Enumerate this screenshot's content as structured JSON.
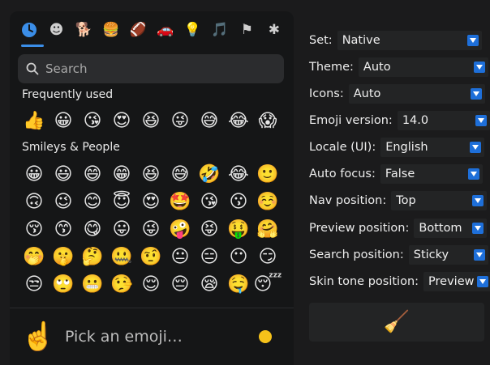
{
  "nav": {
    "categories": [
      {
        "icon": "clock-icon",
        "glyph": "🕒"
      },
      {
        "icon": "smiley-icon",
        "glyph": "☻"
      },
      {
        "icon": "dog-icon",
        "glyph": "🐕"
      },
      {
        "icon": "burger-icon",
        "glyph": "🍔"
      },
      {
        "icon": "football-icon",
        "glyph": "🏈"
      },
      {
        "icon": "car-icon",
        "glyph": "🚗"
      },
      {
        "icon": "lightbulb-icon",
        "glyph": "💡"
      },
      {
        "icon": "symbols-icon",
        "glyph": "🎵"
      },
      {
        "icon": "flag-icon",
        "glyph": "⚑"
      },
      {
        "icon": "asterisk-icon",
        "glyph": "✱"
      }
    ],
    "accent": "#3b8ee8"
  },
  "search": {
    "placeholder": "Search"
  },
  "sections": {
    "frequent": {
      "title": "Frequently used",
      "emojis": [
        "👍",
        "😀",
        "😘",
        "😍",
        "😆",
        "😜",
        "😅",
        "😂",
        "😱"
      ]
    },
    "smileys": {
      "title": "Smileys & People",
      "rows": [
        [
          "😀",
          "😃",
          "😄",
          "😁",
          "😆",
          "😅",
          "🤣",
          "😂",
          "🙂"
        ],
        [
          "🙃",
          "😉",
          "😊",
          "😇",
          "😍",
          "🤩",
          "😘",
          "😗",
          "☺️"
        ],
        [
          "😚",
          "😙",
          "😋",
          "😛",
          "😜",
          "🤪",
          "😝",
          "🤑",
          "🤗"
        ],
        [
          "🤭",
          "🤫",
          "🤔",
          "🤐",
          "🤨",
          "😐",
          "😑",
          "😶",
          "😏"
        ],
        [
          "😒",
          "🙄",
          "😬",
          "🤥",
          "😌",
          "😔",
          "😪",
          "🤤",
          "😴"
        ]
      ]
    }
  },
  "preview": {
    "emoji": "☝️",
    "text": "Pick an emoji…"
  },
  "settings": [
    {
      "label": "Set:",
      "value": "Native"
    },
    {
      "label": "Theme:",
      "value": "Auto"
    },
    {
      "label": "Icons:",
      "value": "Auto"
    },
    {
      "label": "Emoji version:",
      "value": "14.0"
    },
    {
      "label": "Locale (UI):",
      "value": "English"
    },
    {
      "label": "Auto focus:",
      "value": "False"
    },
    {
      "label": "Nav position:",
      "value": "Top"
    },
    {
      "label": "Preview position:",
      "value": "Bottom"
    },
    {
      "label": "Search position:",
      "value": "Sticky"
    },
    {
      "label": "Skin tone position:",
      "value": "Preview"
    }
  ],
  "clear_button": {
    "icon": "broom-icon",
    "glyph": "🧹"
  }
}
